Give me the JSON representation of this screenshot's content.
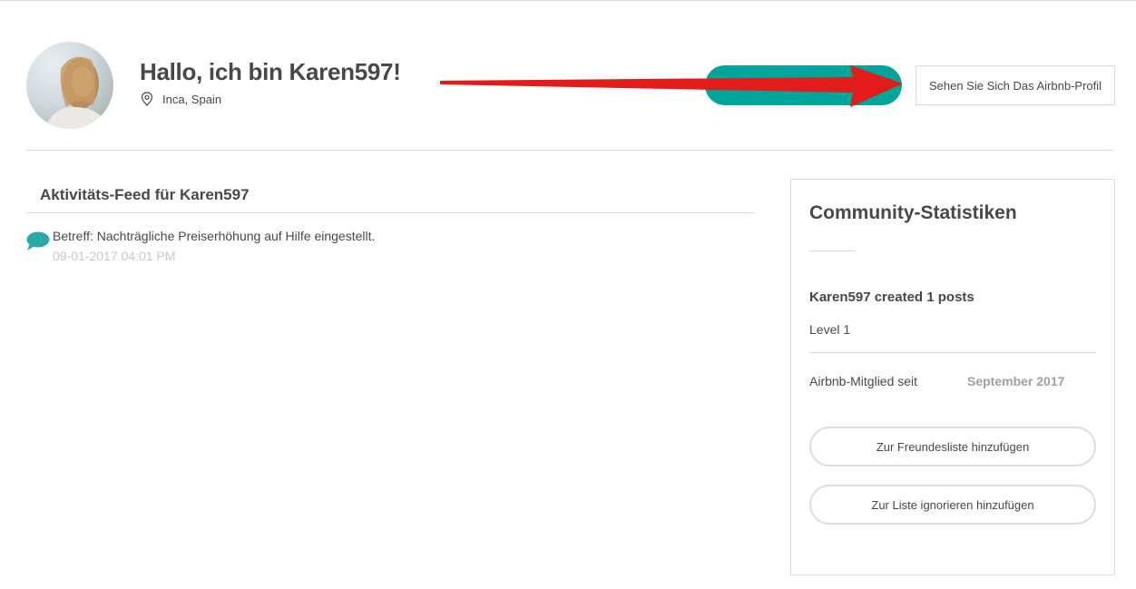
{
  "profile": {
    "greeting": "Hallo, ich bin Karen597!",
    "location": "Inca, Spain",
    "view_profile_label": "Sehen Sie Sich Das Airbnb-Profil"
  },
  "feed": {
    "title": "Aktivitäts-Feed für Karen597",
    "items": [
      {
        "subject": "Betreff: Nachträgliche Preiserhöhung auf Hilfe eingestellt.",
        "date": "09-01-2017 04:01 PM"
      }
    ]
  },
  "stats": {
    "title": "Community-Statistiken",
    "posts": "Karen597 created 1 posts",
    "level": "Level 1",
    "member_label": "Airbnb-Mitglied seit",
    "member_value": "September 2017",
    "add_friend_label": "Zur Freundesliste hinzufügen",
    "ignore_label": "Zur Liste ignorieren hinzufügen"
  },
  "icons": {
    "location": "map-pin-icon",
    "feed_item": "chat-bubble-icon"
  },
  "colors": {
    "accent_teal": "#00a699",
    "annotation_red": "#e31b1b",
    "text": "#484848",
    "muted": "#a0a0a0",
    "border": "#dcdcdc"
  }
}
